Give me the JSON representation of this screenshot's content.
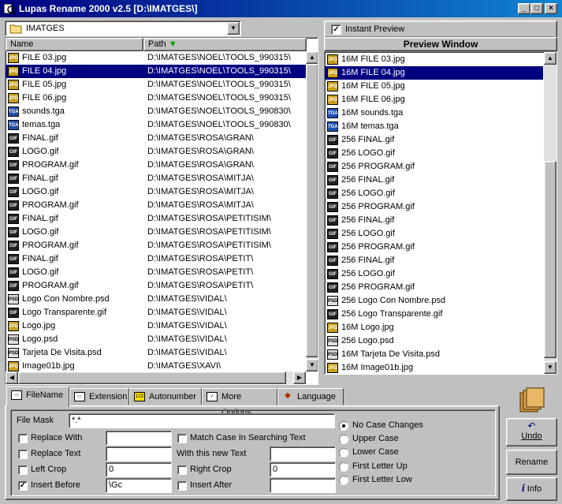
{
  "window": {
    "title": "Lupas Rename 2000 v2.5  [D:\\IMATGES\\]",
    "buttons": {
      "minimize": "_",
      "maximize": "□",
      "close": "×"
    }
  },
  "folder": {
    "value": "IMATGES"
  },
  "left_list": {
    "columns": {
      "name": "Name",
      "path": "Path"
    },
    "rows": [
      {
        "type": "jpg",
        "name": "FILE 03.jpg",
        "path": "D:\\IMATGES\\NOEL\\TOOLS_990315\\"
      },
      {
        "type": "jpg",
        "name": "FILE 04.jpg",
        "path": "D:\\IMATGES\\NOEL\\TOOLS_990315\\"
      },
      {
        "type": "jpg",
        "name": "FILE 05.jpg",
        "path": "D:\\IMATGES\\NOEL\\TOOLS_990315\\"
      },
      {
        "type": "jpg",
        "name": "FILE 06.jpg",
        "path": "D:\\IMATGES\\NOEL\\TOOLS_990315\\"
      },
      {
        "type": "tga",
        "name": "sounds.tga",
        "path": "D:\\IMATGES\\NOEL\\TOOLS_990830\\"
      },
      {
        "type": "tga",
        "name": "temas.tga",
        "path": "D:\\IMATGES\\NOEL\\TOOLS_990830\\"
      },
      {
        "type": "gif",
        "name": "FINAL.gif",
        "path": "D:\\IMATGES\\ROSA\\GRAN\\"
      },
      {
        "type": "gif",
        "name": "LOGO.gif",
        "path": "D:\\IMATGES\\ROSA\\GRAN\\"
      },
      {
        "type": "gif",
        "name": "PROGRAM.gif",
        "path": "D:\\IMATGES\\ROSA\\GRAN\\"
      },
      {
        "type": "gif",
        "name": "FINAL.gif",
        "path": "D:\\IMATGES\\ROSA\\MITJA\\"
      },
      {
        "type": "gif",
        "name": "LOGO.gif",
        "path": "D:\\IMATGES\\ROSA\\MITJA\\"
      },
      {
        "type": "gif",
        "name": "PROGRAM.gif",
        "path": "D:\\IMATGES\\ROSA\\MITJA\\"
      },
      {
        "type": "gif",
        "name": "FINAL.gif",
        "path": "D:\\IMATGES\\ROSA\\PETITISIM\\"
      },
      {
        "type": "gif",
        "name": "LOGO.gif",
        "path": "D:\\IMATGES\\ROSA\\PETITISIM\\"
      },
      {
        "type": "gif",
        "name": "PROGRAM.gif",
        "path": "D:\\IMATGES\\ROSA\\PETITISIM\\"
      },
      {
        "type": "gif",
        "name": "FINAL.gif",
        "path": "D:\\IMATGES\\ROSA\\PETIT\\"
      },
      {
        "type": "gif",
        "name": "LOGO.gif",
        "path": "D:\\IMATGES\\ROSA\\PETIT\\"
      },
      {
        "type": "gif",
        "name": "PROGRAM.gif",
        "path": "D:\\IMATGES\\ROSA\\PETIT\\"
      },
      {
        "type": "psd",
        "name": "Logo Con Nombre.psd",
        "path": "D:\\IMATGES\\VIDAL\\"
      },
      {
        "type": "gif",
        "name": "Logo Transparente.gif",
        "path": "D:\\IMATGES\\VIDAL\\"
      },
      {
        "type": "jpg",
        "name": "Logo.jpg",
        "path": "D:\\IMATGES\\VIDAL\\"
      },
      {
        "type": "psd",
        "name": "Logo.psd",
        "path": "D:\\IMATGES\\VIDAL\\"
      },
      {
        "type": "psd",
        "name": "Tarjeta De Visita.psd",
        "path": "D:\\IMATGES\\VIDAL\\"
      },
      {
        "type": "jpg",
        "name": "Image01b.jpg",
        "path": "D:\\IMATGES\\XAVI\\"
      }
    ],
    "selected_index": 1
  },
  "preview": {
    "instant_label": "Instant Preview",
    "instant_checked": true,
    "title": "Preview Window",
    "rows": [
      {
        "type": "jpg",
        "name": "16M FILE 03.jpg"
      },
      {
        "type": "jpg",
        "name": "16M FILE 04.jpg"
      },
      {
        "type": "jpg",
        "name": "16M FILE 05.jpg"
      },
      {
        "type": "jpg",
        "name": "16M FILE 06.jpg"
      },
      {
        "type": "tga",
        "name": "16M sounds.tga"
      },
      {
        "type": "tga",
        "name": "16M temas.tga"
      },
      {
        "type": "gif",
        "name": "256 FINAL.gif"
      },
      {
        "type": "gif",
        "name": "256 LOGO.gif"
      },
      {
        "type": "gif",
        "name": "256 PROGRAM.gif"
      },
      {
        "type": "gif",
        "name": "256 FINAL.gif"
      },
      {
        "type": "gif",
        "name": "256 LOGO.gif"
      },
      {
        "type": "gif",
        "name": "256 PROGRAM.gif"
      },
      {
        "type": "gif",
        "name": "256 FINAL.gif"
      },
      {
        "type": "gif",
        "name": "256 LOGO.gif"
      },
      {
        "type": "gif",
        "name": "256 PROGRAM.gif"
      },
      {
        "type": "gif",
        "name": "256 FINAL.gif"
      },
      {
        "type": "gif",
        "name": "256 LOGO.gif"
      },
      {
        "type": "gif",
        "name": "256 PROGRAM.gif"
      },
      {
        "type": "psd",
        "name": "256 Logo Con Nombre.psd"
      },
      {
        "type": "gif",
        "name": "256 Logo Transparente.gif"
      },
      {
        "type": "jpg",
        "name": "16M Logo.jpg"
      },
      {
        "type": "psd",
        "name": "256 Logo.psd"
      },
      {
        "type": "psd",
        "name": "16M Tarjeta De Visita.psd"
      },
      {
        "type": "jpg",
        "name": "16M Image01b.jpg"
      }
    ],
    "selected_index": 1
  },
  "tabs": [
    {
      "label": "FileName",
      "icon": "file",
      "active": true
    },
    {
      "label": "Extension",
      "icon": "ext"
    },
    {
      "label": "Autonumber",
      "icon": "123"
    },
    {
      "label": "More Options",
      "icon": "check"
    },
    {
      "label": "Language",
      "icon": "lips"
    }
  ],
  "filename_tab": {
    "file_mask_label": "File Mask",
    "file_mask_value": "*.*",
    "replace_with_label": "Replace With",
    "replace_with_value": "",
    "replace_text_label": "Replace Text",
    "replace_text_value": "",
    "left_crop_label": "Left Crop",
    "left_crop_value": "0",
    "insert_before_label": "Insert Before",
    "insert_before_value": "\\Gc",
    "insert_before_checked": true,
    "match_case_label": "Match Case In Searching Text",
    "new_text_label": "With this new Text",
    "new_text_value": "",
    "right_crop_label": "Right Crop",
    "right_crop_value": "0",
    "insert_after_label": "Insert After",
    "insert_after_value": "",
    "case_options": [
      "No Case Changes",
      "Upper Case",
      "Lower Case",
      "First Letter Up",
      "First Letter Low"
    ],
    "case_selected": 0
  },
  "buttons": {
    "undo": "Undo",
    "rename": "Rename",
    "info": "Info"
  }
}
